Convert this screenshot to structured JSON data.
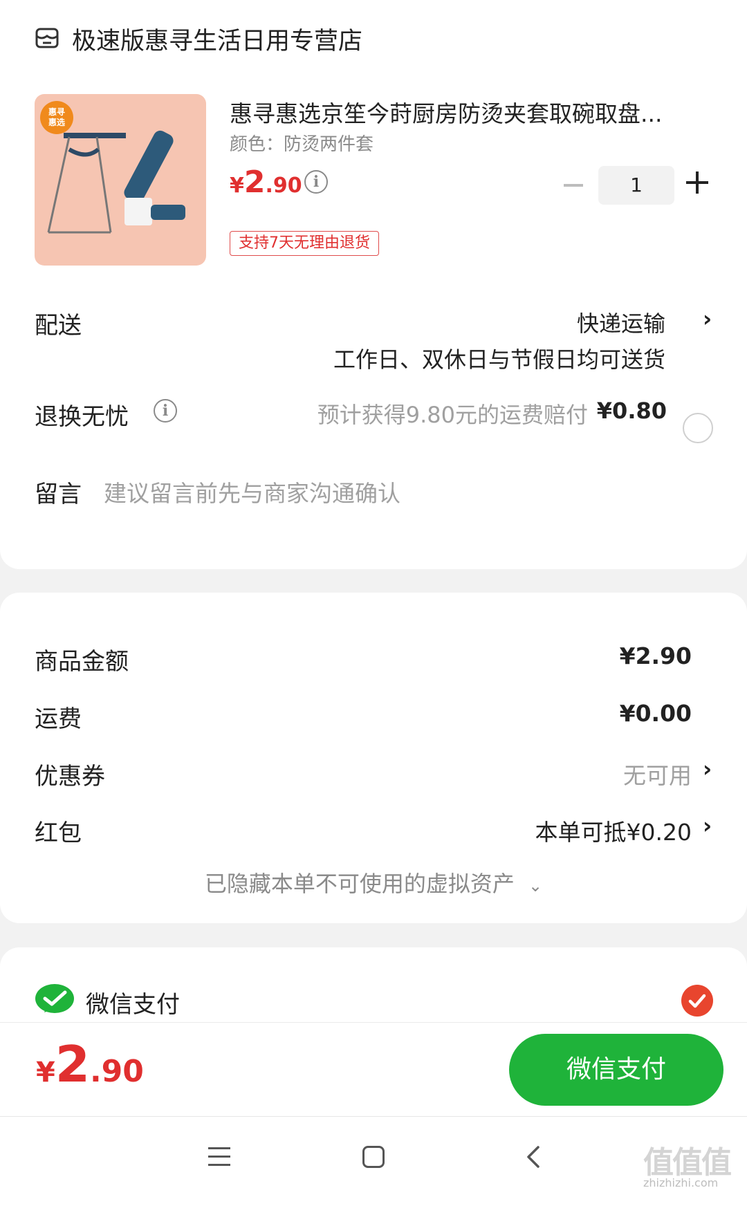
{
  "shop": {
    "name": "极速版惠寻生活日用专营店",
    "icon": "shop-icon"
  },
  "product": {
    "title": "惠寻惠选京笙今莳厨房防烫夹套取碗取盘...",
    "variant": "颜色：防烫两件套",
    "price_symbol": "¥",
    "price_int": "2",
    "price_dec": ".90",
    "quantity": "1",
    "return_tag": "支持7天无理由退货",
    "thumb_badge": "惠寻\n惠选"
  },
  "delivery": {
    "label": "配送",
    "method": "快递运输",
    "note": "工作日、双休日与节假日均可送货"
  },
  "return_worry": {
    "label": "退换无忧",
    "desc": "预计获得9.80元的运费赔付",
    "price": "¥0.80"
  },
  "message": {
    "label": "留言",
    "placeholder": "建议留言前先与商家沟通确认"
  },
  "summary": {
    "goods_amount_label": "商品金额",
    "goods_amount": "¥2.90",
    "shipping_label": "运费",
    "shipping": "¥0.00",
    "coupon_label": "优惠券",
    "coupon_value": "无可用",
    "redpacket_label": "红包",
    "redpacket_value": "本单可抵¥0.20",
    "hidden_assets": "已隐藏本单不可使用的虚拟资产"
  },
  "payment": {
    "method_label": "微信支付"
  },
  "bottom": {
    "total_symbol": "¥",
    "total_int": "2",
    "total_dec": ".90",
    "pay_button": "微信支付"
  },
  "watermark": {
    "main": "值值值",
    "sub": "zhizhizhi.com"
  },
  "colors": {
    "price_red": "#e02f2f",
    "wechat_green": "#1fb33a",
    "check_red": "#e8452e"
  }
}
